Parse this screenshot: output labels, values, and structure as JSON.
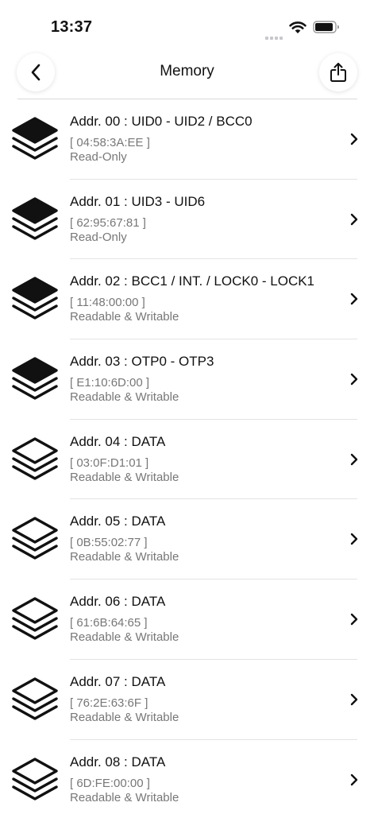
{
  "status_bar": {
    "time": "13:37",
    "icons": [
      "signal-dots-icon",
      "wifi-icon",
      "battery-icon"
    ]
  },
  "nav": {
    "title": "Memory",
    "back_icon": "chevron-left-icon",
    "share_icon": "share-icon"
  },
  "rows": [
    {
      "title": "Addr. 00 : UID0 - UID2 / BCC0",
      "value": "[ 04:58:3A:EE ]",
      "access": "Read-Only",
      "icon": "layers-filled-icon"
    },
    {
      "title": "Addr. 01 : UID3 - UID6",
      "value": "[ 62:95:67:81 ]",
      "access": "Read-Only",
      "icon": "layers-filled-icon"
    },
    {
      "title": "Addr. 02 : BCC1 / INT. / LOCK0 - LOCK1",
      "value": "[ 11:48:00:00 ]",
      "access": "Readable & Writable",
      "icon": "layers-filled-icon"
    },
    {
      "title": "Addr. 03 : OTP0 - OTP3",
      "value": "[ E1:10:6D:00 ]",
      "access": "Readable & Writable",
      "icon": "layers-filled-icon"
    },
    {
      "title": "Addr. 04 : DATA",
      "value": "[ 03:0F:D1:01 ]",
      "access": "Readable & Writable",
      "icon": "layers-outline-icon"
    },
    {
      "title": "Addr. 05 : DATA",
      "value": "[ 0B:55:02:77 ]",
      "access": "Readable & Writable",
      "icon": "layers-outline-icon"
    },
    {
      "title": "Addr. 06 : DATA",
      "value": "[ 61:6B:64:65 ]",
      "access": "Readable & Writable",
      "icon": "layers-outline-icon"
    },
    {
      "title": "Addr. 07 : DATA",
      "value": "[ 76:2E:63:6F ]",
      "access": "Readable & Writable",
      "icon": "layers-outline-icon"
    },
    {
      "title": "Addr. 08 : DATA",
      "value": "[ 6D:FE:00:00 ]",
      "access": "Readable & Writable",
      "icon": "layers-outline-icon"
    }
  ]
}
